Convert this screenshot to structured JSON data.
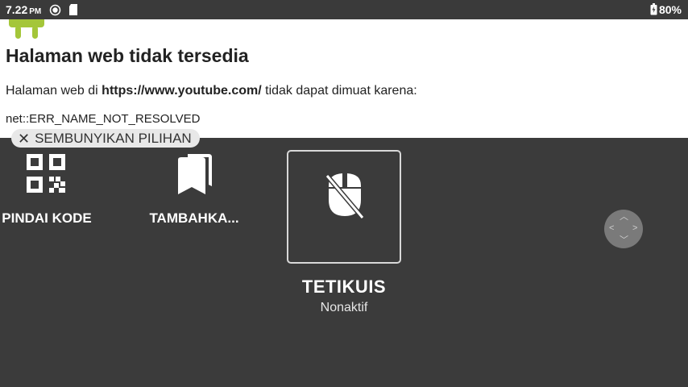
{
  "status_bar": {
    "time": "7.22",
    "ampm": "PM",
    "battery": "80%",
    "icons": [
      "record-icon",
      "sd-card-icon",
      "battery-icon"
    ]
  },
  "webpage": {
    "title": "Halaman web tidak tersedia",
    "body_prefix": "Halaman web di ",
    "url": "https://www.youtube.com/",
    "body_suffix": " tidak dapat dimuat karena:",
    "error": "net::ERR_NAME_NOT_RESOLVED"
  },
  "panel": {
    "hide_label": "SEMBUNYIKAN PILIHAN",
    "options": {
      "scan": "PINDAI KODE",
      "bookmark": "TAMBAHKA..."
    },
    "mouse": {
      "title": "TETIKUIS",
      "status": "Nonaktif"
    }
  },
  "colors": {
    "panel_bg": "#3b3b3b",
    "status_bg": "#3a3a3a",
    "android_green": "#a4c639"
  }
}
